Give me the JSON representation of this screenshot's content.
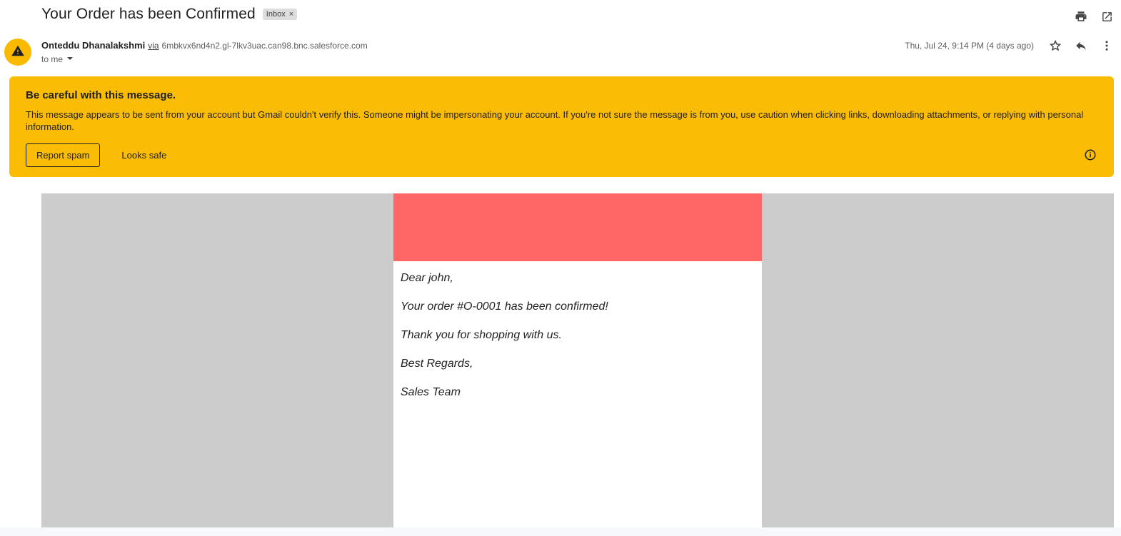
{
  "message": {
    "subject": "Your Order has been Confirmed",
    "label": "Inbox",
    "label_remove": "×"
  },
  "sender": {
    "name": "Onteddu Dhanalakshmi",
    "via": "via",
    "domain": "6mbkvx6nd4n2.gl-7lkv3uac.can98.bnc.salesforce.com",
    "recipient": "to me",
    "date": "Thu, Jul 24, 9:14 PM (4 days ago)"
  },
  "warning": {
    "title": "Be careful with this message.",
    "body": "This message appears to be sent from your account but Gmail couldn't verify this. Someone might be impersonating your account. If you're not sure the message is from you, use caution when clicking links, downloading attachments, or replying with personal information.",
    "report_spam": "Report spam",
    "looks_safe": "Looks safe"
  },
  "email": {
    "greeting": "Dear john,",
    "line1": "Your order #O-0001 has been confirmed!",
    "line2": "Thank you for shopping with us.",
    "closing": "Best Regards,",
    "signature": "Sales Team"
  },
  "icons": {
    "print": "print-icon",
    "open_new_window": "open-in-new-window-icon",
    "star": "star-icon",
    "reply": "reply-icon",
    "more": "more-vert-icon",
    "warning_avatar": "warning-icon",
    "dropdown": "caret-down-icon",
    "info": "info-icon"
  },
  "colors": {
    "warning_bg": "#fabc05",
    "avatar_bg": "#f9ba00",
    "email_banner": "#ff6767",
    "email_outer_bg": "#cccccc"
  }
}
